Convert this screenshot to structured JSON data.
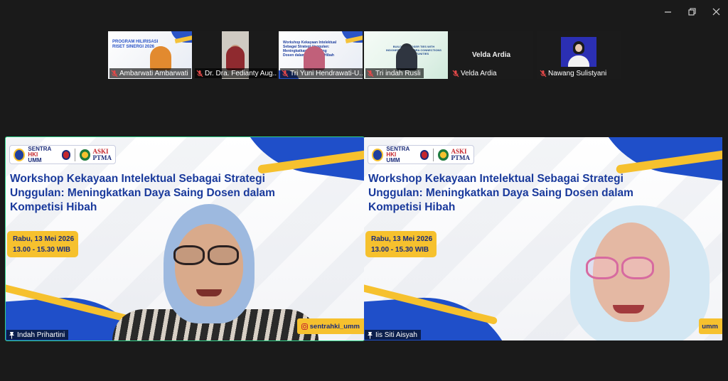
{
  "window": {
    "controls": [
      "minimize-icon",
      "restore-icon",
      "close-icon"
    ]
  },
  "thumbnails": [
    {
      "name": "Ambarwati Ambarwati",
      "type": "slide",
      "slide_title": "PROGRAM HILIRISASI RISET SINERGI 2026",
      "muted": true
    },
    {
      "name": "Dr. Dra. Fedianty Aug...",
      "type": "video",
      "muted": true
    },
    {
      "name": "Tri Yuni Hendrawati-U...",
      "type": "slide",
      "slide_title": "Workshop Kekayaan Intelektual Sebagai Strategi Unggulan: Meningkatkan Daya Saing Dosen dalam Kompetisi Hibah",
      "muted": true
    },
    {
      "name": "Tri indah Rusli",
      "type": "slide-green",
      "slide_title": "BUILDING CLOSER TIES WITH INDONESIAN DIASPORA CONNECTIONS AND OPPORTUNITIES",
      "muted": true
    },
    {
      "name": "Velda Ardia",
      "type": "name-only",
      "display": "Velda Ardia",
      "muted": true
    },
    {
      "name": "Nawang Sulistyani",
      "type": "avatar",
      "muted": true
    }
  ],
  "main_tiles": [
    {
      "participant": "Indah Prihartini",
      "active_speaker": true,
      "logo": {
        "line1_a": "SENTRA ",
        "line1_b": "HKI",
        "line2": "UMM",
        "aski_top": "ASKI",
        "aski_bottom": "PTMA"
      },
      "slide_title": "Workshop Kekayaan Intelektual Sebagai Strategi Unggulan: Meningkatkan Daya Saing Dosen dalam Kompetisi Hibah",
      "date_line": "Rabu, 13 Mei 2026",
      "time_line": "13.00 - 15.30 WIB",
      "social": "sentrahki_umm"
    },
    {
      "participant": "Iis Siti Aisyah",
      "active_speaker": false,
      "logo": {
        "line1_a": "SENTRA ",
        "line1_b": "HKI",
        "line2": "UMM",
        "aski_top": "ASKI",
        "aski_bottom": "PTMA"
      },
      "slide_title": "Workshop Kekayaan Intelektual Sebagai Strategi Unggulan: Meningkatkan Daya Saing Dosen dalam Kompetisi Hibah",
      "date_line": "Rabu, 13 Mei 2026",
      "time_line": "13.00 - 15.30 WIB",
      "social": "umm"
    }
  ],
  "colors": {
    "background": "#1a1a1a",
    "active_border": "#2fd389",
    "slide_blue": "#1f4fc9",
    "slide_yellow": "#f6c12e",
    "muted_red": "#e34848"
  }
}
